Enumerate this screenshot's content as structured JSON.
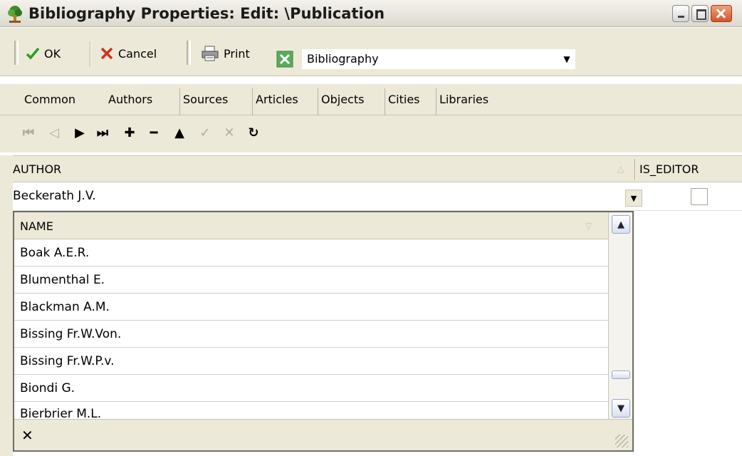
{
  "window": {
    "title": "Bibliography Properties: Edit: \\Publication",
    "icon": "tree-app-icon"
  },
  "toolbar": {
    "ok_label": "OK",
    "cancel_label": "Cancel",
    "print_label": "Print",
    "dataset_combo_value": "Bibliography"
  },
  "tabs": [
    {
      "label": "Common"
    },
    {
      "label": "Authors"
    },
    {
      "label": "Sources"
    },
    {
      "label": "Articles"
    },
    {
      "label": "Objects"
    },
    {
      "label": "Cities"
    },
    {
      "label": "Libraries"
    }
  ],
  "navigator": {
    "icons": [
      "first-record-icon",
      "prior-record-icon",
      "next-record-icon",
      "last-record-icon",
      "insert-record-icon",
      "delete-record-icon",
      "edit-record-icon",
      "post-record-icon",
      "cancel-edit-icon",
      "refresh-icon"
    ]
  },
  "grid": {
    "columns": [
      "AUTHOR",
      "IS_EDITOR"
    ],
    "rows": [
      {
        "author": "Beckerath J.V.",
        "is_editor": false
      }
    ]
  },
  "dropdown": {
    "column": "NAME",
    "items": [
      "Boak A.E.R.",
      "Blumenthal E.",
      "Blackman A.M.",
      "Bissing Fr.W.Von.",
      "Bissing Fr.W.P.v.",
      "Biondi G.",
      "Bierbrier M.L."
    ]
  },
  "colors": {
    "toolbar_bg": "#ece9d8",
    "ok_check": "#2f9e1f",
    "cancel_x": "#d0301c",
    "close_button": "#d4542c"
  }
}
